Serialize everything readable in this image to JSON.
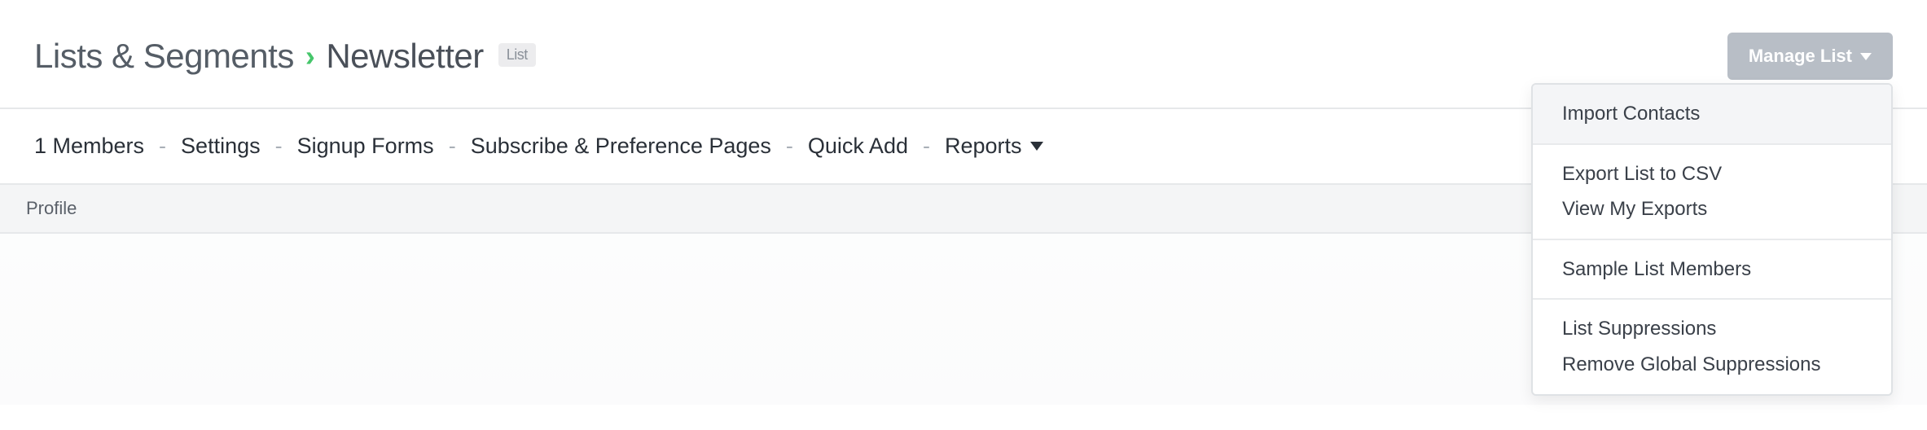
{
  "breadcrumb": {
    "root": "Lists & Segments",
    "separator": "›",
    "current": "Newsletter",
    "badge": "List"
  },
  "manage_button": {
    "label": "Manage List"
  },
  "subnav": {
    "members": "1 Members",
    "settings": "Settings",
    "signup_forms": "Signup Forms",
    "subscribe_pages": "Subscribe & Preference Pages",
    "quick_add": "Quick Add",
    "reports": "Reports",
    "separator": "-"
  },
  "table": {
    "col_profile": "Profile"
  },
  "dropdown": {
    "import_contacts": "Import Contacts",
    "export_csv": "Export List to CSV",
    "view_exports": "View My Exports",
    "sample_members": "Sample List Members",
    "list_suppressions": "List Suppressions",
    "remove_global": "Remove Global Suppressions"
  }
}
